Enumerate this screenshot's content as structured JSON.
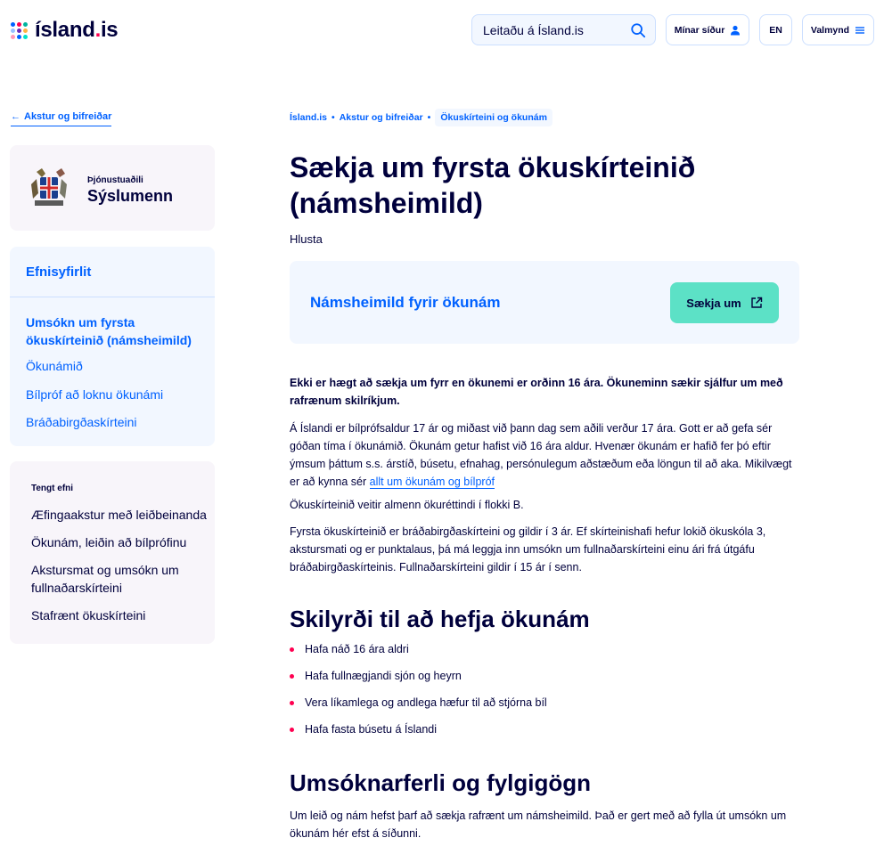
{
  "header": {
    "logo_text": "ísland",
    "logo_dot": ".",
    "logo_tld": "is",
    "search_placeholder": "Leitaðu á Ísland.is",
    "my_pages_label": "Mínar síður",
    "lang_label": "EN",
    "menu_label": "Valmynd",
    "logo_colors": [
      "#0061ff",
      "#ff0050",
      "#00b39e",
      "#99c0ff",
      "#6a2eb8",
      "#ffb342",
      "#ff99b9",
      "#0061ff",
      "#00e4ca"
    ]
  },
  "sidebar": {
    "back_label": "Akstur og bifreiðar",
    "org": {
      "kicker": "Þjónustuaðili",
      "name": "Sýslumenn"
    },
    "toc": {
      "title": "Efnisyfirlit",
      "active": "Umsókn um fyrsta ökuskírteinið (námsheimild)",
      "items": [
        "Ökunámið",
        "Bílpróf að loknu ökunámi",
        "Bráðabirgðaskírteini"
      ]
    },
    "related": {
      "title": "Tengt efni",
      "items": [
        "Æfingaakstur með leiðbeinanda",
        "Ökunám, leiðin að bílprófinu",
        "Akstursmat og umsókn um fullnaðarskírteini",
        "Stafrænt ökuskírteini"
      ]
    }
  },
  "main": {
    "breadcrumb": [
      "Ísland.is",
      "Akstur og bifreiðar",
      "Ökuskírteini og ökunám"
    ],
    "breadcrumb_sep": "•",
    "title": "Sækja um fyrsta ökuskírteinið (námsheimild)",
    "listen": "Hlusta",
    "apply_card": {
      "title": "Námsheimild fyrir ökunám",
      "button": "Sækja um"
    },
    "lead": "Ekki er hægt að sækja um fyrr en ökunemi er orðinn 16 ára. Ökuneminn sækir sjálfur um með rafrænum skilríkjum.",
    "para1": "Á Íslandi er bílprófsaldur 17 ár og miðast við þann dag sem aðili verður 17 ára. Gott er að gefa sér góðan tíma í ökunámið. Ökunám getur hafist við 16 ára aldur. Hvenær ökunám er hafið fer þó eftir ýmsum þáttum s.s. árstíð, búsetu, efnahag, persónulegum aðstæðum eða löngun til að aka. Mikilvægt er að kynna sér ",
    "para1_link": "allt um ökunám og bílpróf",
    "para2": "Ökuskírteinið veitir almenn ökuréttindi í flokki B.",
    "para3": "Fyrsta ökuskírteinið er bráðabirgðaskírteini og gildir í 3 ár. Ef skírteinishafi hefur lokið ökuskóla 3, akstursmati og er punktalaus, þá má leggja inn umsókn um fullnaðarskírteini einu ári frá útgáfu bráðabirgðaskírteinis. Fullnaðarskírteini gildir í 15 ár í senn.",
    "h2_conditions": "Skilyrði til að hefja ökunám",
    "conditions": [
      "Hafa náð 16 ára aldri",
      "Hafa fullnægjandi sjón og heyrn",
      "Vera líkamlega og andlega hæfur til að stjórna bíl",
      "Hafa fasta búsetu á Íslandi"
    ],
    "h2_process": "Umsóknarferli og fylgigögn",
    "para4": "Um leið og nám hefst þarf að sækja rafrænt um námsheimild. Það er gert með að fylla út umsókn um ökunám hér efst á síðunni."
  }
}
